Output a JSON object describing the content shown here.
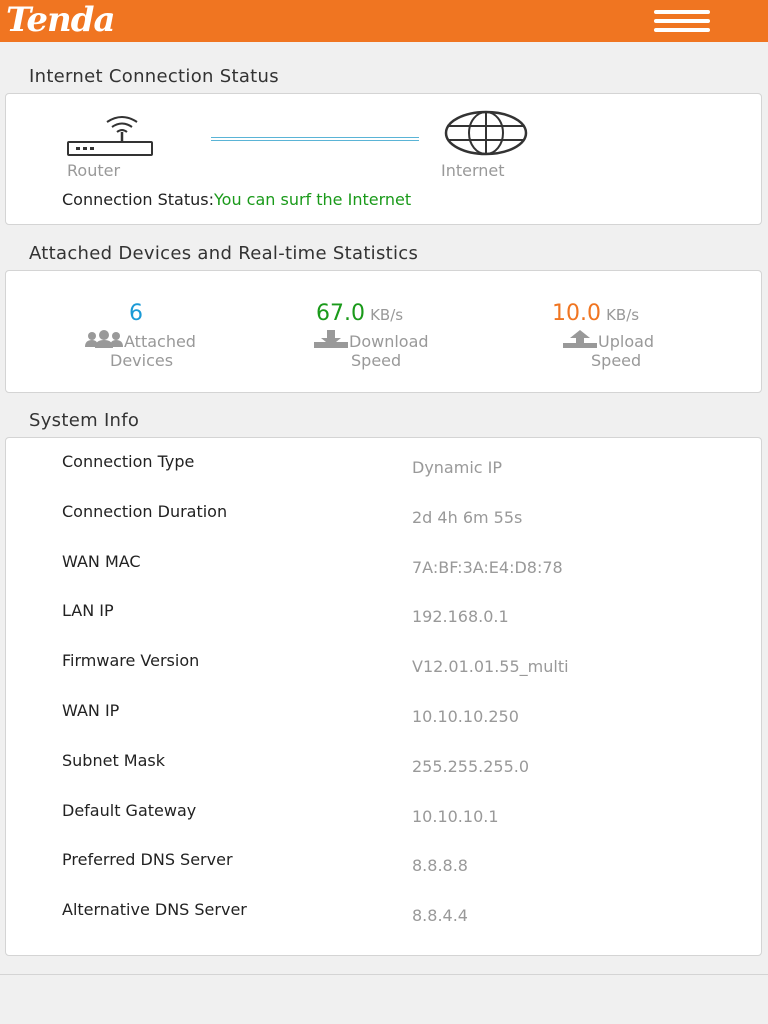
{
  "header": {
    "logo_text": "Tenda",
    "brand_color": "#f07521",
    "menu_icon": "hamburger-menu-icon"
  },
  "connection": {
    "section_title": "Internet Connection Status",
    "router_label": "Router",
    "internet_label": "Internet",
    "status_label": "Connection Status:",
    "status_value": "You can surf the Internet",
    "status_color": "#1a9a1a",
    "router_icon": "router-icon",
    "internet_icon": "globe-icon"
  },
  "statistics": {
    "section_title": "Attached Devices and Real-time Statistics",
    "devices": {
      "value": "6",
      "label": "Attached",
      "label2": "Devices",
      "color": "#1a9ad6",
      "icon": "users-icon"
    },
    "download": {
      "value": "67.0",
      "unit": "KB/s",
      "label": "Download",
      "label2": "Speed",
      "color": "#1a9a1a",
      "icon": "download-icon"
    },
    "upload": {
      "value": "10.0",
      "unit": "KB/s",
      "label": "Upload",
      "label2": "Speed",
      "color": "#f07521",
      "icon": "upload-icon"
    }
  },
  "system_info": {
    "section_title": "System Info",
    "rows": [
      {
        "key": "Connection Type",
        "value": "Dynamic IP"
      },
      {
        "key": "Connection Duration",
        "value": "2d 4h 6m 55s"
      },
      {
        "key": "WAN MAC",
        "value": "7A:BF:3A:E4:D8:78"
      },
      {
        "key": "LAN IP",
        "value": "192.168.0.1"
      },
      {
        "key": "Firmware Version",
        "value": "V12.01.01.55_multi"
      },
      {
        "key": "WAN IP",
        "value": "10.10.10.250"
      },
      {
        "key": "Subnet Mask",
        "value": "255.255.255.0"
      },
      {
        "key": "Default Gateway",
        "value": "10.10.10.1"
      },
      {
        "key": "Preferred DNS Server",
        "value": "8.8.8.8"
      },
      {
        "key": "Alternative DNS Server",
        "value": "8.8.4.4"
      }
    ]
  }
}
